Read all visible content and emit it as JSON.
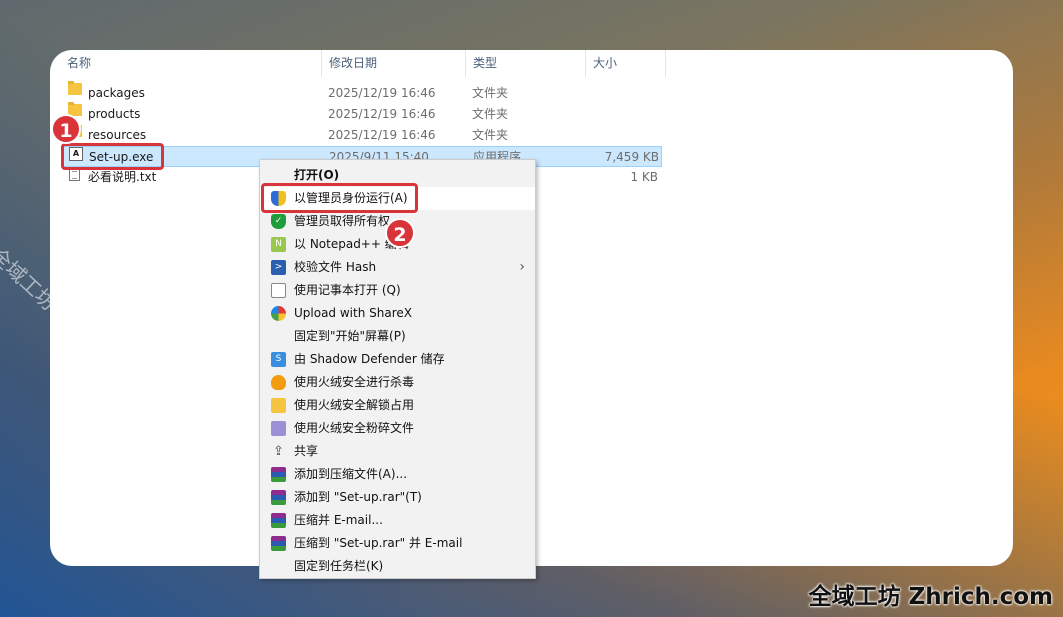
{
  "columns": {
    "name": "名称",
    "modified": "修改日期",
    "type": "类型",
    "size": "大小"
  },
  "files": [
    {
      "name": "packages",
      "date": "2025/12/19 16:46",
      "type": "文件夹",
      "size": "",
      "icon": "folder-icon"
    },
    {
      "name": "products",
      "date": "2025/12/19 16:46",
      "type": "文件夹",
      "size": "",
      "icon": "folder-icon"
    },
    {
      "name": "resources",
      "date": "2025/12/19 16:46",
      "type": "文件夹",
      "size": "",
      "icon": "folder-icon"
    },
    {
      "name": "Set-up.exe",
      "date": "2025/9/11 15:40",
      "type": "应用程序",
      "size": "7,459 KB",
      "icon": "exe-icon"
    },
    {
      "name": "必看说明.txt",
      "date": "",
      "type": "",
      "size": "1 KB",
      "icon": "txt-icon"
    }
  ],
  "menu": [
    {
      "label": "打开(O)",
      "icon": ""
    },
    {
      "label": "以管理员身份运行(A)",
      "icon": "uac-shield-icon"
    },
    {
      "label": "管理员取得所有权",
      "icon": "green-shield-icon"
    },
    {
      "label": "以 Notepad++ 编辑",
      "icon": "notepadpp-icon"
    },
    {
      "label": "校验文件 Hash",
      "icon": "powershell-icon"
    },
    {
      "label": "使用记事本打开 (Q)",
      "icon": "notepad-icon"
    },
    {
      "label": "Upload with ShareX",
      "icon": "sharex-icon"
    },
    {
      "label": "固定到\"开始\"屏幕(P)",
      "icon": ""
    },
    {
      "label": "由 Shadow Defender 储存",
      "icon": "shadow-defender-icon"
    },
    {
      "label": "使用火绒安全进行杀毒",
      "icon": "huorong-icon"
    },
    {
      "label": "使用火绒安全解锁占用",
      "icon": "folder-lock-icon"
    },
    {
      "label": "使用火绒安全粉碎文件",
      "icon": "shred-icon"
    },
    {
      "label": "共享",
      "icon": "share-icon"
    },
    {
      "label": "添加到压缩文件(A)...",
      "icon": "winrar-icon"
    },
    {
      "label": "添加到 \"Set-up.rar\"(T)",
      "icon": "winrar-icon"
    },
    {
      "label": "压缩并 E-mail...",
      "icon": "winrar-icon"
    },
    {
      "label": "压缩到 \"Set-up.rar\" 并 E-mail",
      "icon": "winrar-icon"
    },
    {
      "label": "固定到任务栏(K)",
      "icon": ""
    }
  ],
  "annotations": {
    "step1": "1",
    "step2": "2"
  },
  "watermark": "全域工坊 zhrich.com",
  "brand": "全域工坊 Zhrich.com",
  "colors": {
    "annotation_red": "#d9343a",
    "selection": "#cce8ff"
  }
}
